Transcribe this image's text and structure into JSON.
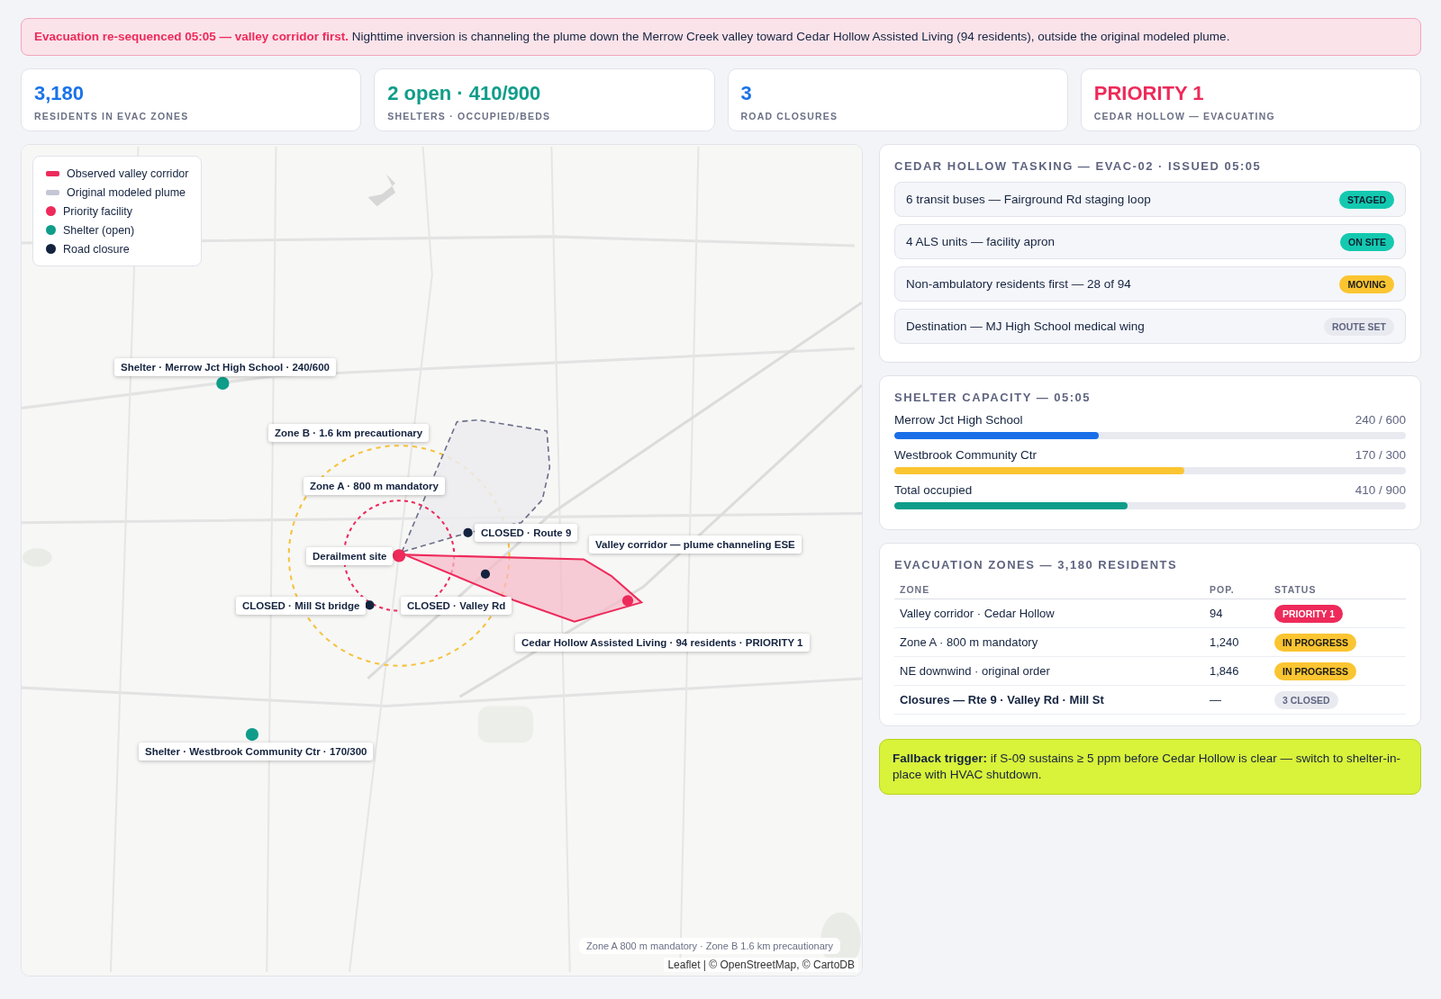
{
  "alert": {
    "text": "**Evacuation re-sequenced 05:05 — valley corridor first.** Nighttime inversion is channeling the plume down the Merrow Creek valley toward Cedar Hollow Assisted Living (94 residents), outside the original modeled plume."
  },
  "kpis": [
    {
      "value": "3,180",
      "label": "RESIDENTS IN EVAC ZONES",
      "color": "#1a73e8"
    },
    {
      "value": "2 open · 410/900",
      "label": "SHELTERS · OCCUPIED/BEDS",
      "color": "#0f9d8a"
    },
    {
      "value": "3",
      "label": "ROAD CLOSURES",
      "color": "#1a73e8"
    },
    {
      "value": "PRIORITY 1",
      "label": "CEDAR HOLLOW — EVACUATING",
      "color": "#ee2a5a"
    }
  ],
  "map": {
    "legend": [
      {
        "label": "Observed valley corridor",
        "kind": "bar",
        "color": "#ee2a5a"
      },
      {
        "label": "Original modeled plume",
        "kind": "bar",
        "color": "#c4c7d4"
      },
      {
        "label": "Priority facility",
        "kind": "dot",
        "color": "#ee2a5a"
      },
      {
        "label": "Shelter (open)",
        "kind": "dot",
        "color": "#0f9d8a"
      },
      {
        "label": "Road closure",
        "kind": "dot",
        "color": "#14233f"
      }
    ],
    "labels": [
      {
        "text": "Shelter · Merrow Jct High School · 240/600"
      },
      {
        "text": "Zone B · 1.6 km precautionary"
      },
      {
        "text": "Zone A · 800 m mandatory"
      },
      {
        "text": "CLOSED · Route 9"
      },
      {
        "text": "Derailment site"
      },
      {
        "text": "Valley corridor — plume channeling ESE"
      },
      {
        "text": "Cedar Hollow Assisted Living · 94 residents · PRIORITY 1"
      },
      {
        "text": "CLOSED · Mill St bridge"
      },
      {
        "text": "CLOSED · Valley Rd"
      },
      {
        "text": "Shelter · Westbrook Community Ctr · 170/300"
      }
    ],
    "note": "Zone A 800 m mandatory · Zone B 1.6 km precautionary",
    "attribution": "Leaflet | © OpenStreetMap, © CartoDB"
  },
  "tasking": {
    "title": "CEDAR HOLLOW TASKING — EVAC-02 · ISSUED 05:05",
    "items": [
      {
        "text": "6 transit buses — Fairground Rd staging loop",
        "status": "STAGED",
        "kind": "done"
      },
      {
        "text": "4 ALS units — facility apron",
        "status": "ON SITE",
        "kind": "done"
      },
      {
        "text": "Non-ambulatory residents first — 28 of 94",
        "status": "MOVING",
        "kind": "active"
      },
      {
        "text": "Destination — MJ High School medical wing",
        "status": "ROUTE SET",
        "kind": "neutral"
      }
    ]
  },
  "shelters": {
    "title": "SHELTER CAPACITY — 05:05",
    "rows": [
      {
        "name": "Merrow Jct High School",
        "reading": "240 / 600",
        "level": 0.4,
        "color": "#1a6fe8"
      },
      {
        "name": "Westbrook Community Ctr",
        "reading": "170 / 300",
        "level": 0.567,
        "color": "#fbc531"
      },
      {
        "name": "Total occupied",
        "reading": "410 / 900",
        "level": 0.456,
        "color": "#0f9d8a"
      }
    ]
  },
  "zones": {
    "title": "EVACUATION ZONES — 3,180 RESIDENTS",
    "columns": [
      "ZONE",
      "POP.",
      "STATUS"
    ],
    "rows": [
      {
        "zone": "Valley corridor · Cedar Hollow",
        "pop": "94",
        "status": "PRIORITY 1",
        "kind": "priority",
        "bold": false
      },
      {
        "zone": "Zone A · 800 m mandatory",
        "pop": "1,240",
        "status": "IN PROGRESS",
        "kind": "progress",
        "bold": false
      },
      {
        "zone": "NE downwind · original order",
        "pop": "1,846",
        "status": "IN PROGRESS",
        "kind": "progress",
        "bold": false
      },
      {
        "zone": "Closures — Rte 9 · Valley Rd · Mill St",
        "pop": "—",
        "status": "3 CLOSED",
        "kind": "neutral",
        "bold": true
      }
    ]
  },
  "fallback": {
    "text": "**Fallback trigger:** if S-09 sustains ≥ 5 ppm before Cedar Hollow is clear — switch to shelter-in-place with HVAC shutdown."
  }
}
